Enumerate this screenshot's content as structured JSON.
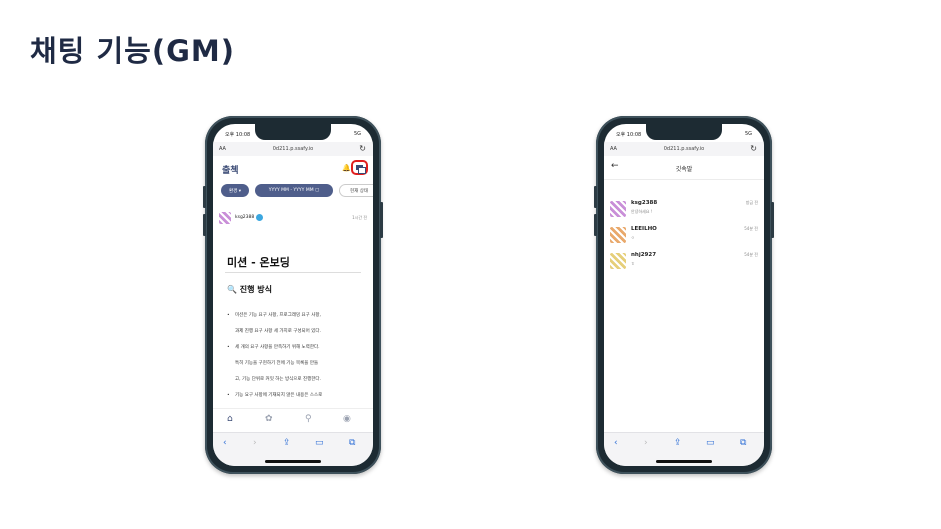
{
  "slide": {
    "title": "채팅 기능(GM)"
  },
  "phone_left": {
    "status": {
      "time": "오후 10:08",
      "signal": "5G"
    },
    "urlbar": {
      "aa": "AA",
      "url": "0d211.p.ssafy.io",
      "reload_icon": "reload-icon"
    },
    "header": {
      "brand": "출첵",
      "bell_icon": "bell-icon",
      "chat_icon": "chat-icon"
    },
    "filters": [
      {
        "label": "환경 ▾"
      },
      {
        "label": "YYYY MM - YYYY MM ▢"
      },
      {
        "label": "현재 상태"
      }
    ],
    "post_user": {
      "name": "ksg2388",
      "time_ago": "1시간 전"
    },
    "mission": {
      "title": "미션 - 온보딩",
      "section": "진행 방식",
      "bullets": [
        {
          "text": "미션은 기능 요구 사항, 프로그래밍 요구 사항,",
          "cont": false
        },
        {
          "text": "과제 진행 요구 사항 세 가지로 구성되어 있다.",
          "cont": true
        },
        {
          "text": "세 개의 요구 사항을 만족하기 위해 노력한다.",
          "cont": false
        },
        {
          "text": "특히 기능을 구현하기 전에 기능 목록을 만들",
          "cont": true
        },
        {
          "text": "고, 기능 단위로 커밋 하는 방식으로 진행한다.",
          "cont": true
        },
        {
          "text": "기능 요구 사항에 기재되지 않은 내용은 스스로",
          "cont": false
        }
      ]
    },
    "tabbar": [
      "home-icon",
      "paw-icon",
      "search-icon",
      "profile-icon"
    ],
    "safari": [
      "back-icon",
      "forward-icon",
      "share-icon",
      "bookmarks-icon",
      "tabs-icon"
    ]
  },
  "phone_right": {
    "status": {
      "time": "오후 10:08",
      "signal": "5G"
    },
    "urlbar": {
      "aa": "AA",
      "url": "0d211.p.ssafy.io",
      "reload_icon": "reload-icon"
    },
    "header": {
      "title": "깃속말",
      "back_icon": "back-arrow-icon"
    },
    "chats": [
      {
        "name": "ksg2388",
        "message": "안녕하세요 !",
        "time_ago": "방금 전",
        "avatar_color": "#c98fd8"
      },
      {
        "name": "LEEILHO",
        "message": "ㅇ",
        "time_ago": "54분 전",
        "avatar_color": "#e9a96c"
      },
      {
        "name": "nhj2927",
        "message": "ㅎ",
        "time_ago": "54분 전",
        "avatar_color": "#e6cf7a"
      }
    ],
    "safari": [
      "back-icon",
      "forward-icon",
      "share-icon",
      "bookmarks-icon",
      "tabs-icon"
    ]
  },
  "colors": {
    "brand": "#3a4a75",
    "chip": "#4f5e8b",
    "highlight": "#e01f1f",
    "verified": "#3ba7e0"
  }
}
